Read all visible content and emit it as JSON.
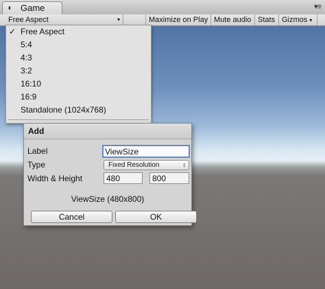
{
  "window": {
    "tab_icon": "unity-icon",
    "tab_title": "Game",
    "menu_glyph": "▾≡"
  },
  "toolbar": {
    "aspect_value": "Free Aspect",
    "maximize_on_play": "Maximize on Play",
    "mute_audio": "Mute audio",
    "stats": "Stats",
    "gizmos": "Gizmos",
    "dropdown_arrow": "▾"
  },
  "aspect_menu": {
    "check_glyph": "✓",
    "items": [
      {
        "label": "Free Aspect",
        "checked": true
      },
      {
        "label": "5:4"
      },
      {
        "label": "4:3"
      },
      {
        "label": "3:2"
      },
      {
        "label": "16:10"
      },
      {
        "label": "16:9"
      },
      {
        "label": "Standalone (1024x768)"
      }
    ]
  },
  "add_dialog": {
    "title": "Add",
    "label_label": "Label",
    "label_value": "ViewSize",
    "type_label": "Type",
    "type_value": "Fixed Resolution",
    "type_arrow": "↕",
    "wh_label": "Width & Height",
    "width_value": "480",
    "height_value": "800",
    "summary": "ViewSize (480x800)",
    "cancel_label": "Cancel",
    "ok_label": "OK"
  },
  "colors": {
    "focus_ring": "#5e8bd4",
    "sky_top": "#5174a6",
    "ground": "#6e6966"
  }
}
